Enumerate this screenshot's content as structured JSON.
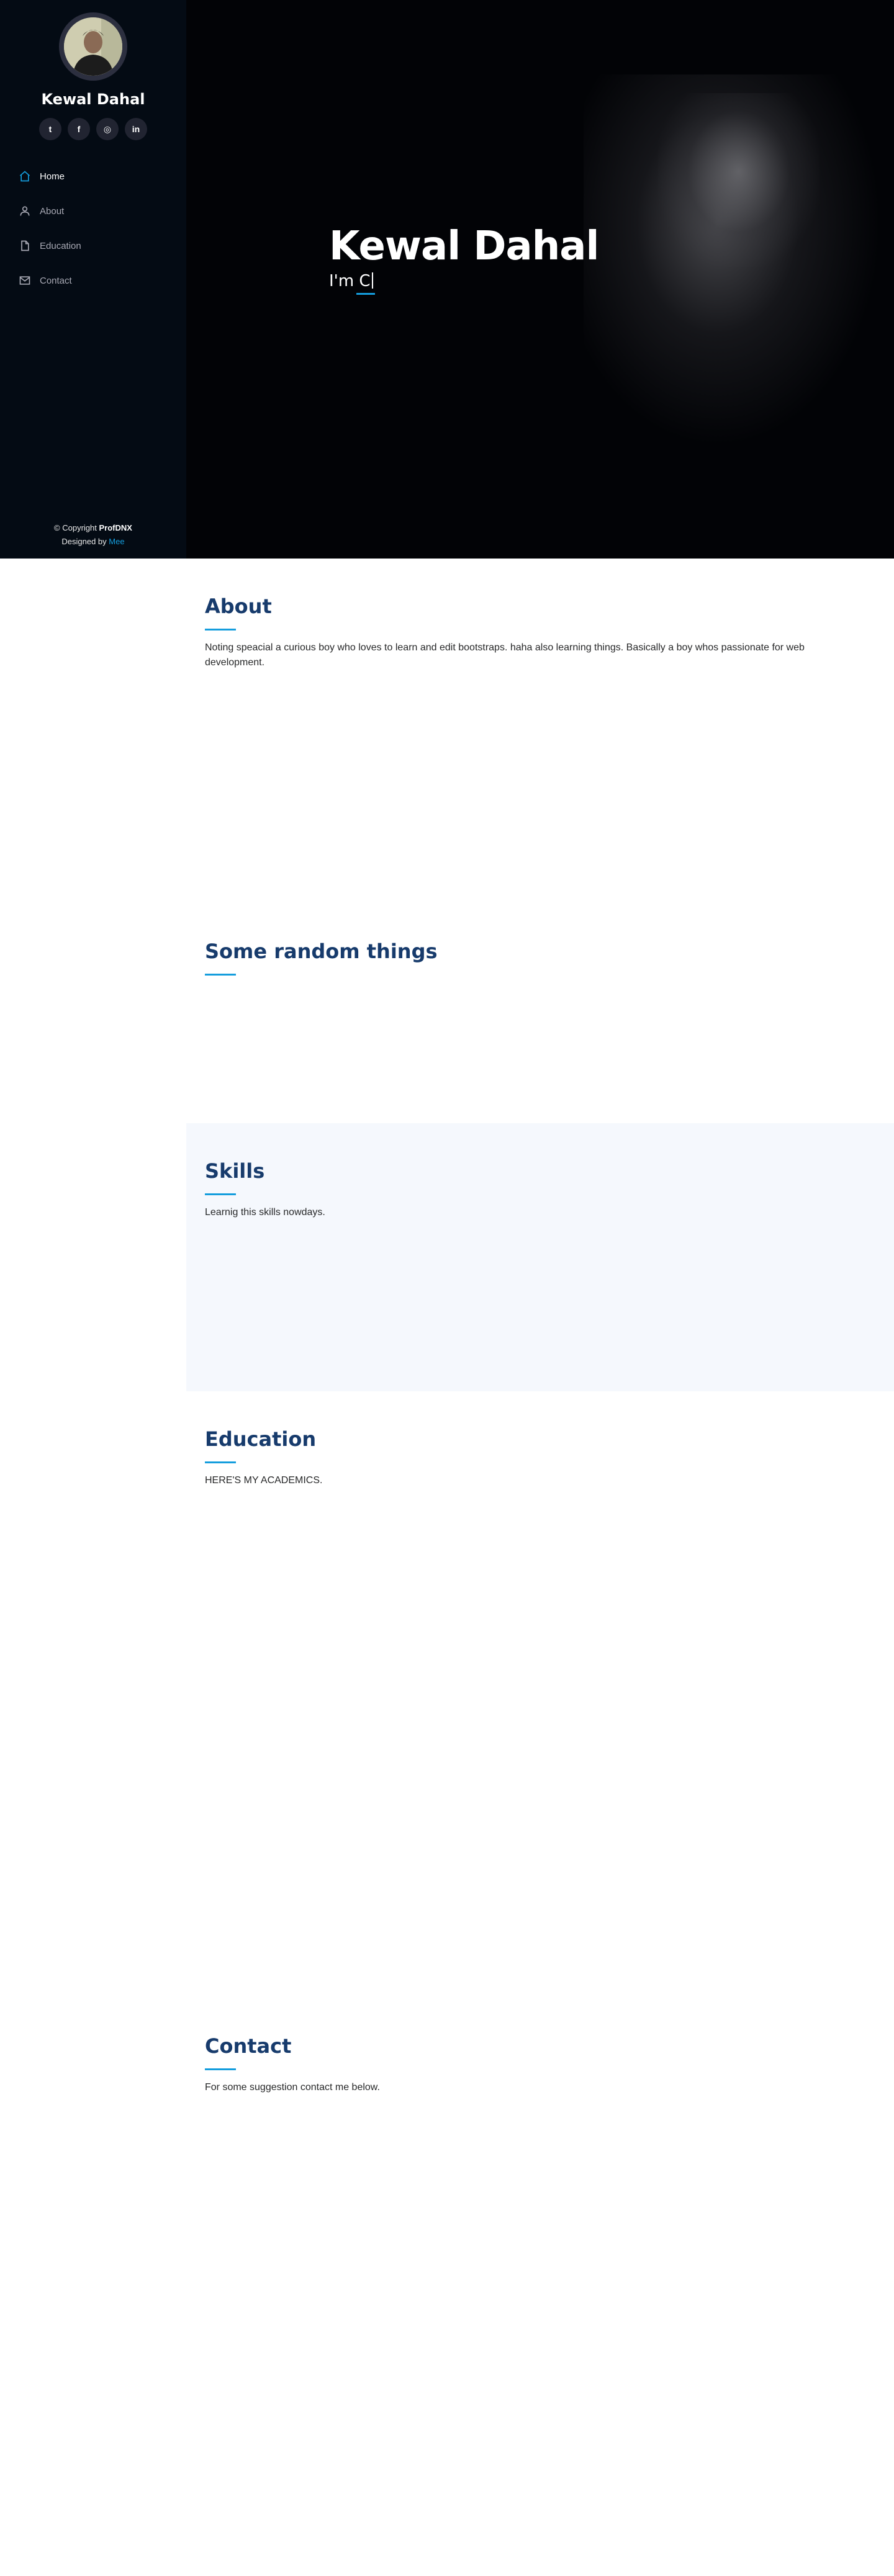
{
  "sidebar": {
    "name": "Kewal Dahal",
    "social": [
      {
        "icon": "twitter-icon",
        "glyph": "t"
      },
      {
        "icon": "facebook-icon",
        "glyph": "f"
      },
      {
        "icon": "instagram-icon",
        "glyph": "◎"
      },
      {
        "icon": "linkedin-icon",
        "glyph": "in"
      }
    ],
    "nav": [
      {
        "label": "Home",
        "icon": "home-icon",
        "active": true
      },
      {
        "label": "About",
        "icon": "person-icon"
      },
      {
        "label": "Education",
        "icon": "file-icon"
      },
      {
        "label": "Contact",
        "icon": "envelope-icon"
      }
    ],
    "footer": {
      "copyright_prefix": "© Copyright",
      "copyright_brand": "ProfDNX",
      "designed_by": "Designed by",
      "designer": "Mee"
    }
  },
  "hero": {
    "title": "Kewal Dahal",
    "typed_text": "I'm C"
  },
  "sections": {
    "about": {
      "title": "About",
      "text": "Noting speacial a curious boy who loves to learn and edit bootstraps. haha also learning things. Basically a boy whos passionate for web development."
    },
    "random": {
      "title": "Some random things"
    },
    "skills": {
      "title": "Skills",
      "text": "Learnig this skills nowdays."
    },
    "education": {
      "title": "Education",
      "text": "HERE'S MY ACADEMICS."
    },
    "contact": {
      "title": "Contact",
      "text": "For some suggestion contact me below."
    }
  },
  "colors": {
    "sidebar_bg": "#040b14",
    "accent": "#149ddd",
    "heading": "#173b6c",
    "alt_section_bg": "#f5f8fd"
  }
}
